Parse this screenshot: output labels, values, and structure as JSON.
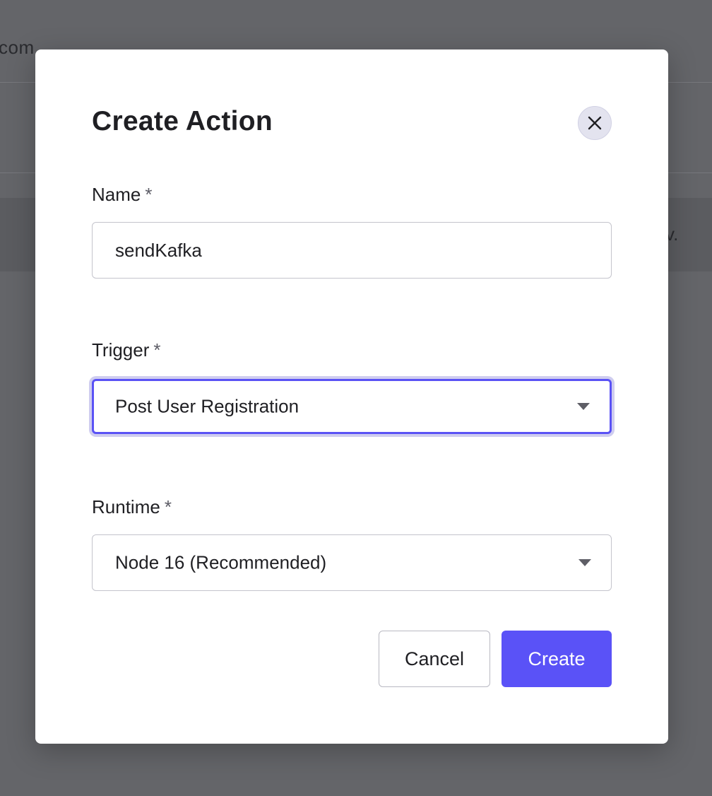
{
  "background": {
    "left_text": "com",
    "right_text": "v."
  },
  "modal": {
    "title": "Create Action",
    "close_icon": "close-icon",
    "fields": {
      "name": {
        "label": "Name",
        "required_mark": "*",
        "value": "sendKafka",
        "placeholder": ""
      },
      "trigger": {
        "label": "Trigger",
        "required_mark": "*",
        "selected": "Post User Registration",
        "focused": true
      },
      "runtime": {
        "label": "Runtime",
        "required_mark": "*",
        "selected": "Node 16 (Recommended)"
      }
    },
    "buttons": {
      "cancel_label": "Cancel",
      "create_label": "Create"
    }
  },
  "colors": {
    "overlay": "#646569",
    "primary": "#5a52f7",
    "focus_ring": "#cfcdef"
  }
}
